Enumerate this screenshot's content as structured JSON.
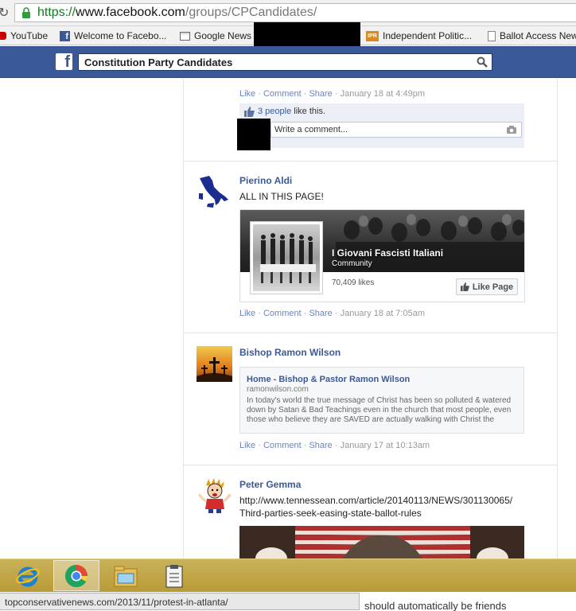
{
  "browser": {
    "url_scheme": "https://",
    "url_host": "www.facebook.com",
    "url_path": "/groups/CPCandidates/",
    "bookmarks": [
      {
        "label": "YouTube",
        "icon": "youtube-icon",
        "color": "#cc0000"
      },
      {
        "label": "Welcome to Facebo...",
        "icon": "facebook-icon",
        "color": "#3b5998"
      },
      {
        "label": "Google News",
        "icon": "news-icon",
        "color": "#666666"
      },
      {
        "label": "Independent Politic...",
        "icon": "ipr-icon",
        "color": "#d98a1a"
      },
      {
        "label": "Ballot Access New",
        "icon": "page-icon",
        "color": "#777777"
      }
    ]
  },
  "header": {
    "search_value": "Constitution Party Candidates",
    "brand_color": "#3b5998"
  },
  "post1": {
    "actions": {
      "like": "Like",
      "comment": "Comment",
      "share": "Share",
      "time": "January 18 at 4:49pm"
    },
    "likes_link": "3 people",
    "likes_suffix": " like this.",
    "comment_placeholder": "Write a comment..."
  },
  "post2": {
    "author": "Pierino Aldi",
    "message": "ALL IN THIS PAGE!",
    "page_card": {
      "title": "I Giovani Fascisti Italiani",
      "category": "Community",
      "likes": "70,409 likes",
      "like_button": "Like Page"
    },
    "actions": {
      "like": "Like",
      "comment": "Comment",
      "share": "Share",
      "time": "January 18 at 7:05am"
    }
  },
  "post3": {
    "author": "Bishop Ramon Wilson",
    "link_card": {
      "title": "Home - Bishop & Pastor Ramon Wilson",
      "domain": "ramonwilson.com",
      "description": "In today's world the true message of Christ has been so polluted & watered down by Satan & Bad Teachings even in the church that most people, even those who believe they are SAVED are actually walking with Christ the"
    },
    "actions": {
      "like": "Like",
      "comment": "Comment",
      "share": "Share",
      "time": "January 17 at 10:13am"
    }
  },
  "post4": {
    "author": "Peter Gemma",
    "message_line1": "http://www.tennessean.com/article/20140113/NEWS/301130065/",
    "message_line2": "Third-parties-seek-easing-state-ballot-rules"
  },
  "status_bar": {
    "hover_url": "topconservativenews.com/2013/11/protest-in-atlanta/",
    "behind_text": "should automatically be friends"
  }
}
